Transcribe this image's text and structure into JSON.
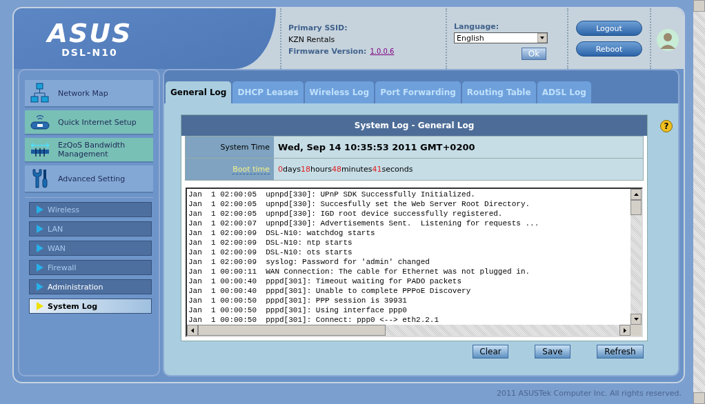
{
  "header": {
    "logo": "ASUS",
    "model": "DSL-N10",
    "ssid_label": "Primary SSID:",
    "ssid": "KZN Rentals",
    "firmware_label": "Firmware Version:",
    "firmware": "1.0.0.6",
    "language_label": "Language:",
    "language": "English",
    "ok_button": "Ok",
    "buttons": [
      "Logout",
      "Reboot"
    ]
  },
  "sidebar": {
    "items": [
      {
        "label": "Network Map",
        "kind": "section"
      },
      {
        "label": "Quick Internet Setup",
        "kind": "wizard"
      },
      {
        "label": "EzQoS Bandwidth Management",
        "kind": "wizard"
      },
      {
        "label": "Advanced Setting",
        "kind": "section"
      }
    ],
    "submenu": [
      {
        "label": "Wireless",
        "selected": false,
        "disabled": true
      },
      {
        "label": "LAN",
        "selected": false,
        "disabled": true
      },
      {
        "label": "WAN",
        "selected": false,
        "disabled": true
      },
      {
        "label": "Firewall",
        "selected": false,
        "disabled": true
      },
      {
        "label": "Administration",
        "selected": false,
        "disabled": false
      },
      {
        "label": "System Log",
        "selected": true,
        "disabled": false
      }
    ]
  },
  "tabs": [
    {
      "label": "General Log",
      "selected": true
    },
    {
      "label": "DHCP Leases",
      "selected": false
    },
    {
      "label": "Wireless Log",
      "selected": false
    },
    {
      "label": "Port Forwarding",
      "selected": false
    },
    {
      "label": "Routing Table",
      "selected": false
    },
    {
      "label": "ADSL Log",
      "selected": false
    }
  ],
  "help": "?",
  "section": {
    "title": "System Log - General Log",
    "system_time_label": "System Time",
    "system_time": "Wed, Sep 14  10:35:53  2011 GMT+0200",
    "boot_time_label": "Boot time",
    "boot_time": [
      {
        "value": "0",
        "unit": "days"
      },
      {
        "value": "18",
        "unit": "hours"
      },
      {
        "value": "48",
        "unit": "minutes"
      },
      {
        "value": "41",
        "unit": "seconds"
      }
    ],
    "log": [
      "Jan  1 02:00:05  upnpd[330]: UPnP SDK Successfully Initialized.",
      "Jan  1 02:00:05  upnpd[330]: Succesfully set the Web Server Root Directory.",
      "Jan  1 02:00:05  upnpd[330]: IGD root device successfully registered.",
      "Jan  1 02:00:07  upnpd[330]: Advertisements Sent.  Listening for requests ...",
      "Jan  1 02:00:09  DSL-N10: watchdog starts",
      "Jan  1 02:00:09  DSL-N10: ntp starts",
      "Jan  1 02:00:09  DSL-N10: ots starts",
      "Jan  1 02:00:09  syslog: Password for 'admin' changed",
      "Jan  1 00:00:11  WAN Connection: The cable for Ethernet was not plugged in.",
      "Jan  1 00:00:40  pppd[301]: Timeout waiting for PADO packets",
      "Jan  1 00:00:40  pppd[301]: Unable to complete PPPoE Discovery",
      "Jan  1 00:00:50  pppd[301]: PPP session is 39931",
      "Jan  1 00:00:50  pppd[301]: Using interface ppp0",
      "Jan  1 00:00:50  pppd[301]: Connect: ppp0 <--> eth2.2.1"
    ],
    "buttons": [
      "Clear",
      "Save",
      "Refresh"
    ]
  },
  "footer": "2011 ASUSTek Computer Inc. All rights reserved."
}
